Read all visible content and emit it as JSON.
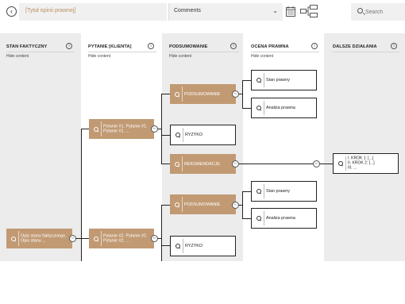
{
  "topbar": {
    "back_icon": "chevron-left-icon",
    "title_placeholder": "[Tytuł opinii prawnej]",
    "comments_label": "Comments",
    "comments_icon": "chevron-down-icon",
    "view_icons": [
      "calendar-grid-icon",
      "flow-diagram-icon"
    ],
    "search_placeholder": "Search"
  },
  "columns": [
    {
      "title": "STAN FAKTYCZNY",
      "hide": "Hide content"
    },
    {
      "title": "PYTANIE [KLIENTA]",
      "hide": "Hide content"
    },
    {
      "title": "PODSUMOWANIE",
      "hide": "Hide content"
    },
    {
      "title": "OCENA PRAWNA",
      "hide": "Hide content"
    },
    {
      "title": "DALSZE DZIAŁANIA",
      "hide": ""
    }
  ],
  "info_icon": "i",
  "connector_label": "+/-",
  "nodes": {
    "stan": "Opis stanu faktycznego. Opis stanu ...",
    "q1": "Pytanie #1. Pytanie #1. Pytanie #1. ...",
    "q2": "Pytanie #2. Pytanie #2. Pytanie #2. ...",
    "p1": "PODSUMOWANIE",
    "r1": "RYZYKO",
    "rek": "REKOMENDACJE",
    "p2": "PODSUMOWANIE",
    "r2": "RYZYKO",
    "o1": "Stan prawny",
    "o2": "Analiza prawna",
    "o3": "Stan prawny",
    "o4": "Analiza prawna",
    "d1": "I. KROK 1: [...]\nII. KROK 2: [...]\nIII. ..."
  },
  "colors": {
    "accent_brown": "#c19a73",
    "column_gray": "#ececec",
    "title_placeholder_color": "#b89060"
  }
}
